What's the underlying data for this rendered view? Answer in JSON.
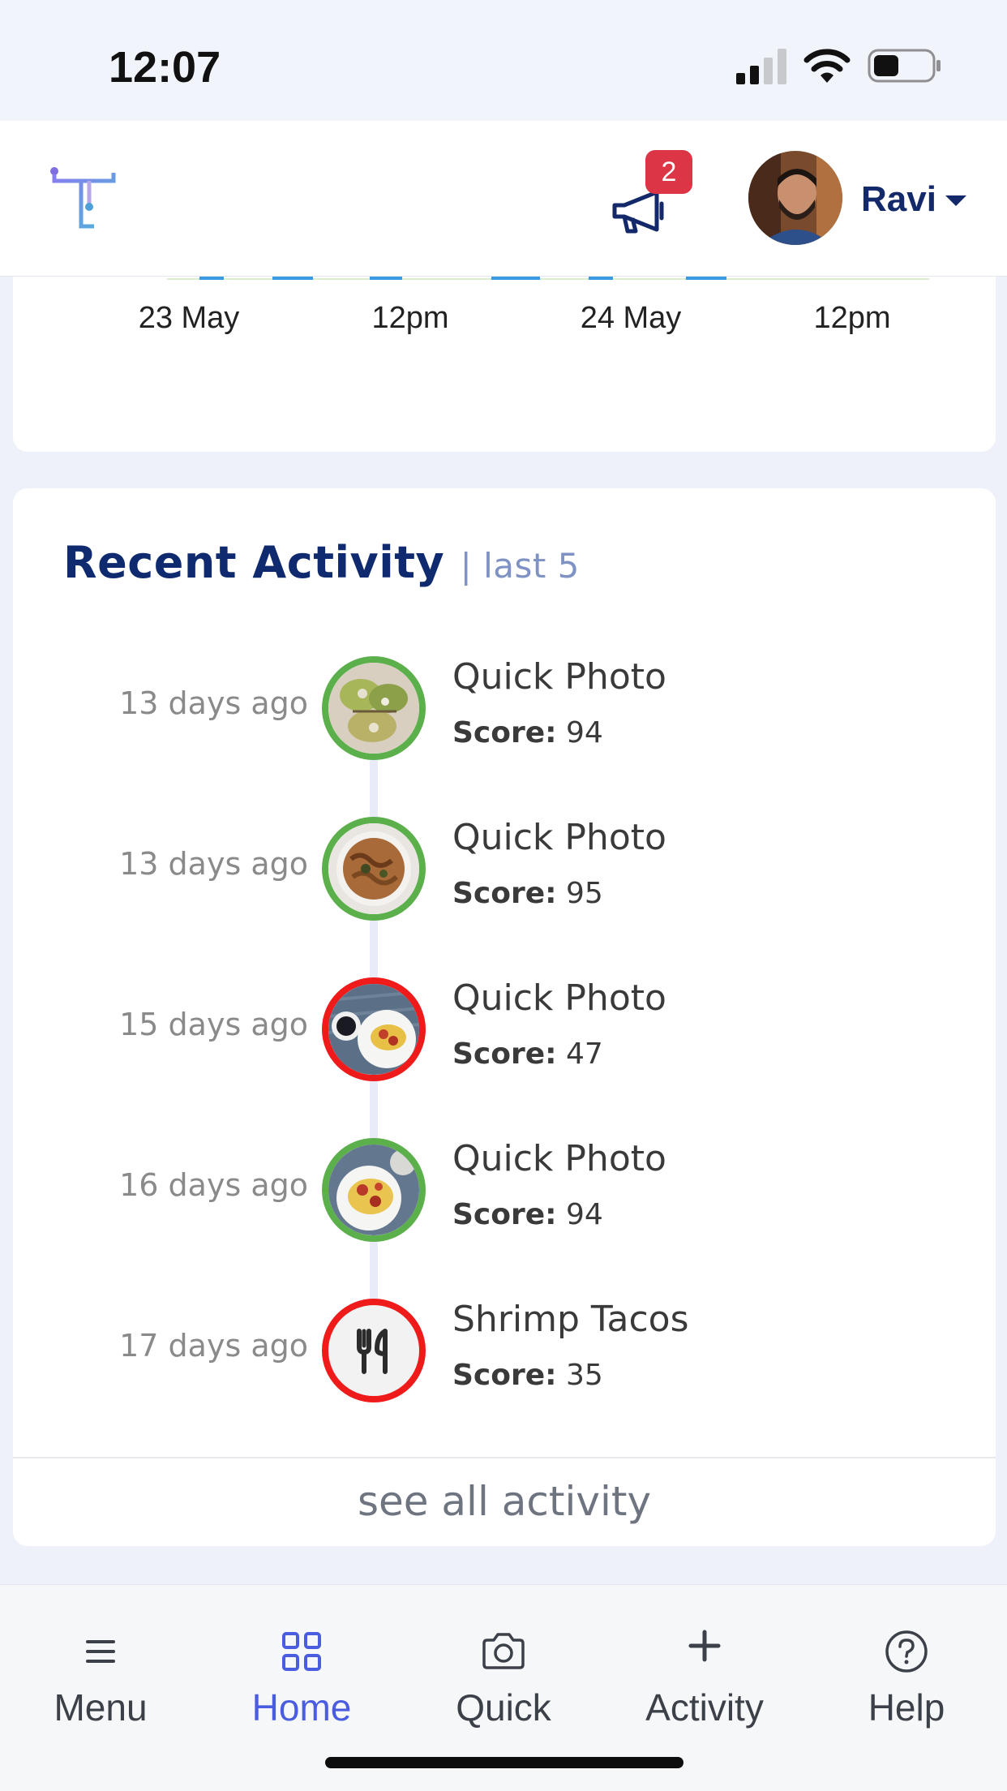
{
  "status_bar": {
    "time": "12:07"
  },
  "header": {
    "notification_count": "2",
    "user_name": "Ravi"
  },
  "chart_axis": {
    "ticks": [
      "23 May",
      "12pm",
      "24 May",
      "12pm"
    ]
  },
  "activity": {
    "title": "Recent Activity",
    "subtitle": "| last 5",
    "score_label": "Score:",
    "items": [
      {
        "time": "13 days ago",
        "title": "Quick Photo",
        "score": "94",
        "status": "good"
      },
      {
        "time": "13 days ago",
        "title": "Quick Photo",
        "score": "95",
        "status": "good"
      },
      {
        "time": "15 days ago",
        "title": "Quick Photo",
        "score": "47",
        "status": "bad"
      },
      {
        "time": "16 days ago",
        "title": "Quick Photo",
        "score": "94",
        "status": "good"
      },
      {
        "time": "17 days ago",
        "title": "Shrimp Tacos",
        "score": "35",
        "status": "bad"
      }
    ],
    "see_all_label": "see all activity"
  },
  "tabs": [
    {
      "label": "Menu",
      "icon": "hamburger-icon"
    },
    {
      "label": "Home",
      "icon": "grid-icon",
      "active": true
    },
    {
      "label": "Quick",
      "icon": "camera-icon"
    },
    {
      "label": "Activity",
      "icon": "plus-icon"
    },
    {
      "label": "Help",
      "icon": "help-circle-icon"
    }
  ],
  "colors": {
    "brand_navy": "#0f2a6e",
    "good_ring": "#5cb04b",
    "bad_ring": "#ef1a1a",
    "active_tab": "#4a5ce0",
    "badge": "#dc3545"
  }
}
